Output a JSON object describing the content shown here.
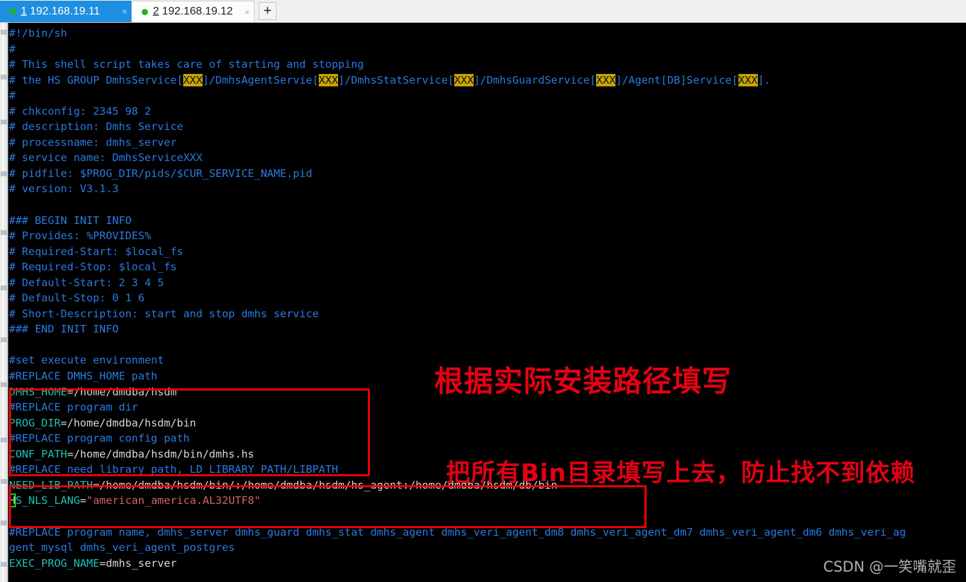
{
  "window": {
    "tabs": [
      {
        "index": "1",
        "host": "192.168.19.11",
        "status_dot": "green-dot-icon",
        "close": "×",
        "active": true
      },
      {
        "index": "2",
        "host": "192.168.19.12",
        "status_dot": "green-dot-icon",
        "close": "×",
        "active": false
      }
    ],
    "new_tab_label": "+"
  },
  "colors": {
    "tab_active_bg": "#1e8fe0",
    "status_dot": "#1ab81a",
    "comment": "#2a7ae2",
    "variable": "#18c2b8",
    "string": "#d4655f",
    "highlight_bg": "#c8a400",
    "annotation": "#e60012",
    "cursor_outline": "#19d219",
    "terminal_bg": "#000000"
  },
  "terminal": {
    "lines": [
      [
        {
          "t": "#!/bin/sh",
          "c": "cmt"
        }
      ],
      [
        {
          "t": "#",
          "c": "cmt"
        }
      ],
      [
        {
          "t": "# This shell script takes care of starting and stopping",
          "c": "cmt"
        }
      ],
      [
        {
          "t": "# the HS GROUP DmhsService[",
          "c": "cmt"
        },
        {
          "t": "XXX",
          "c": "hl"
        },
        {
          "t": "]/DmhsAgentServie[",
          "c": "cmt"
        },
        {
          "t": "XXX",
          "c": "hl"
        },
        {
          "t": "]/DmhsStatService[",
          "c": "cmt"
        },
        {
          "t": "XXX",
          "c": "hl"
        },
        {
          "t": "]/DmhsGuardService[",
          "c": "cmt"
        },
        {
          "t": "XXX",
          "c": "hl"
        },
        {
          "t": "]/Agent[DB]Service[",
          "c": "cmt"
        },
        {
          "t": "XXX",
          "c": "hl"
        },
        {
          "t": "].",
          "c": "cmt"
        }
      ],
      [
        {
          "t": "#",
          "c": "cmt"
        }
      ],
      [
        {
          "t": "# chkconfig: 2345 98 2",
          "c": "cmt"
        }
      ],
      [
        {
          "t": "# description: Dmhs Service",
          "c": "cmt"
        }
      ],
      [
        {
          "t": "# processname: dmhs_server",
          "c": "cmt"
        }
      ],
      [
        {
          "t": "# service name: DmhsServiceXXX",
          "c": "cmt"
        }
      ],
      [
        {
          "t": "# pidfile: $PROG_DIR/pids/$CUR_SERVICE_NAME.pid",
          "c": "cmt"
        }
      ],
      [
        {
          "t": "# version: V3.1.3",
          "c": "cmt"
        }
      ],
      [
        {
          "t": "",
          "c": "cmt"
        }
      ],
      [
        {
          "t": "### BEGIN INIT INFO",
          "c": "cmt"
        }
      ],
      [
        {
          "t": "# Provides: %PROVIDES%",
          "c": "cmt"
        }
      ],
      [
        {
          "t": "# Required-Start: $local_fs",
          "c": "cmt"
        }
      ],
      [
        {
          "t": "# Required-Stop: $local_fs",
          "c": "cmt"
        }
      ],
      [
        {
          "t": "# Default-Start: 2 3 4 5",
          "c": "cmt"
        }
      ],
      [
        {
          "t": "# Default-Stop: 0 1 6",
          "c": "cmt"
        }
      ],
      [
        {
          "t": "# Short-Description: start and stop dmhs service",
          "c": "cmt"
        }
      ],
      [
        {
          "t": "### END INIT INFO",
          "c": "cmt"
        }
      ],
      [
        {
          "t": "",
          "c": "cmt"
        }
      ],
      [
        {
          "t": "#set execute environment",
          "c": "cmt"
        }
      ],
      [
        {
          "t": "#REPLACE DMHS_HOME path",
          "c": "cmt"
        }
      ],
      [
        {
          "t": "DMHS_HOME",
          "c": "var"
        },
        {
          "t": "=/home/dmdba/hsdm",
          "c": "plain"
        }
      ],
      [
        {
          "t": "#REPLACE program dir",
          "c": "cmt"
        }
      ],
      [
        {
          "t": "PROG_DIR",
          "c": "var"
        },
        {
          "t": "=/home/dmdba/hsdm/bin",
          "c": "plain"
        }
      ],
      [
        {
          "t": "#REPLACE program config path",
          "c": "cmt"
        }
      ],
      [
        {
          "t": "CONF_PATH",
          "c": "var"
        },
        {
          "t": "=/home/dmdba/hsdm/bin/dmhs.hs",
          "c": "plain"
        }
      ],
      [
        {
          "t": "#REPLACE need library path, LD_LIBRARY_PATH/LIBPATH",
          "c": "cmt"
        }
      ],
      [
        {
          "t": "NEED_LIB_PATH",
          "c": "var"
        },
        {
          "t": "=/home/dmdba/hsdm/bin/:/home/dmdba/hsdm/hs_agent:/home/dmdba/hsdm/db/bin",
          "c": "plain"
        }
      ],
      [
        {
          "t": "H",
          "c": "cursor"
        },
        {
          "t": "S_NLS_LANG",
          "c": "var"
        },
        {
          "t": "=",
          "c": "plain"
        },
        {
          "t": "\"american_america.AL32UTF8\"",
          "c": "str"
        }
      ],
      [
        {
          "t": "",
          "c": "cmt"
        }
      ],
      [
        {
          "t": "#REPLACE program name, dmhs_server dmhs_guard dmhs_stat dmhs_agent dmhs_veri_agent_dm8 dmhs_veri_agent_dm7 dmhs_veri_agent_dm6 dmhs_veri_ag",
          "c": "cmt"
        }
      ],
      [
        {
          "t": "gent_mysql dmhs_veri_agent_postgres",
          "c": "cmt"
        }
      ],
      [
        {
          "t": "EXEC_PROG_NAME",
          "c": "var"
        },
        {
          "t": "=dmhs_server",
          "c": "plain"
        }
      ]
    ]
  },
  "annotations": [
    {
      "id": "annot-1",
      "text": "根据实际安装路径填写"
    },
    {
      "id": "annot-2",
      "text": "把所有Bin目录填写上去，防止找不到依赖"
    }
  ],
  "highlight_boxes": [
    {
      "name": "redbox-home-paths"
    },
    {
      "name": "redbox-lib-paths"
    }
  ],
  "watermark": {
    "text": "CSDN @一笑嘴就歪"
  }
}
